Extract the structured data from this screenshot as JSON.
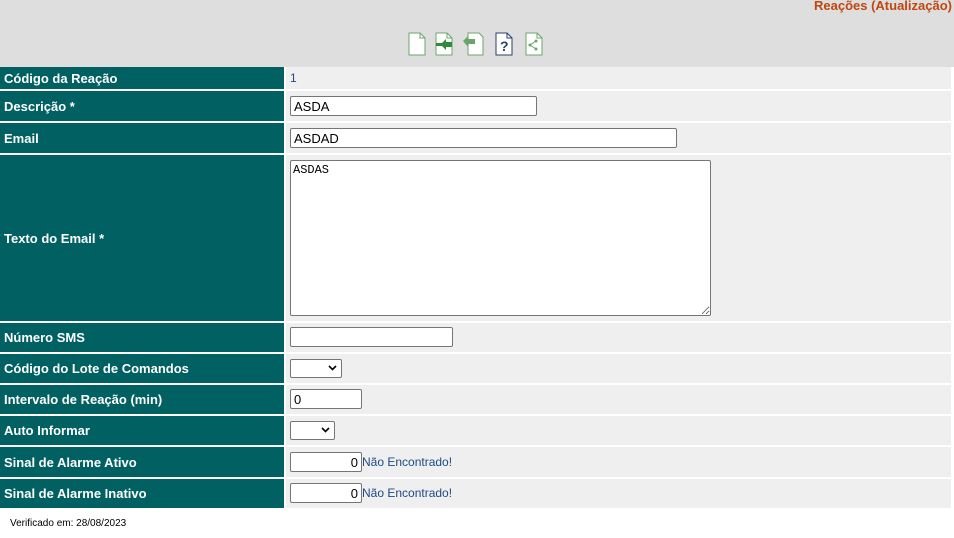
{
  "header": {
    "title": "Reações (Atualização)",
    "toolbar": [
      {
        "icon": "new-document-icon"
      },
      {
        "icon": "export-document-icon"
      },
      {
        "icon": "undo-document-icon"
      },
      {
        "icon": "help-document-icon"
      },
      {
        "icon": "share-document-icon"
      }
    ]
  },
  "form": {
    "codigo_label": "Código da Reação",
    "codigo_value": "1",
    "descricao_label": "Descrição *",
    "descricao_value": "ASDA",
    "email_label": "Email",
    "email_value": "ASDAD",
    "texto_label": "Texto do Email *",
    "texto_value": "ASDAS",
    "sms_label": "Número SMS",
    "sms_value": "",
    "lote_label": "Código do Lote de Comandos",
    "lote_value": "",
    "intervalo_label": "Intervalo de Reação (min)",
    "intervalo_value": "0",
    "auto_label": "Auto Informar",
    "auto_value": "",
    "ativo_label": "Sinal de Alarme Ativo",
    "ativo_value": "0",
    "ativo_status": "Não Encontrado!",
    "inativo_label": "Sinal de Alarme Inativo",
    "inativo_value": "0",
    "inativo_status": "Não Encontrado!"
  },
  "footer": {
    "verified": "Verificado em: 28/08/2023"
  },
  "colors": {
    "label_bg": "#006062",
    "field_bg": "#efefef",
    "title": "#c0470f",
    "link": "#1d4a87"
  }
}
